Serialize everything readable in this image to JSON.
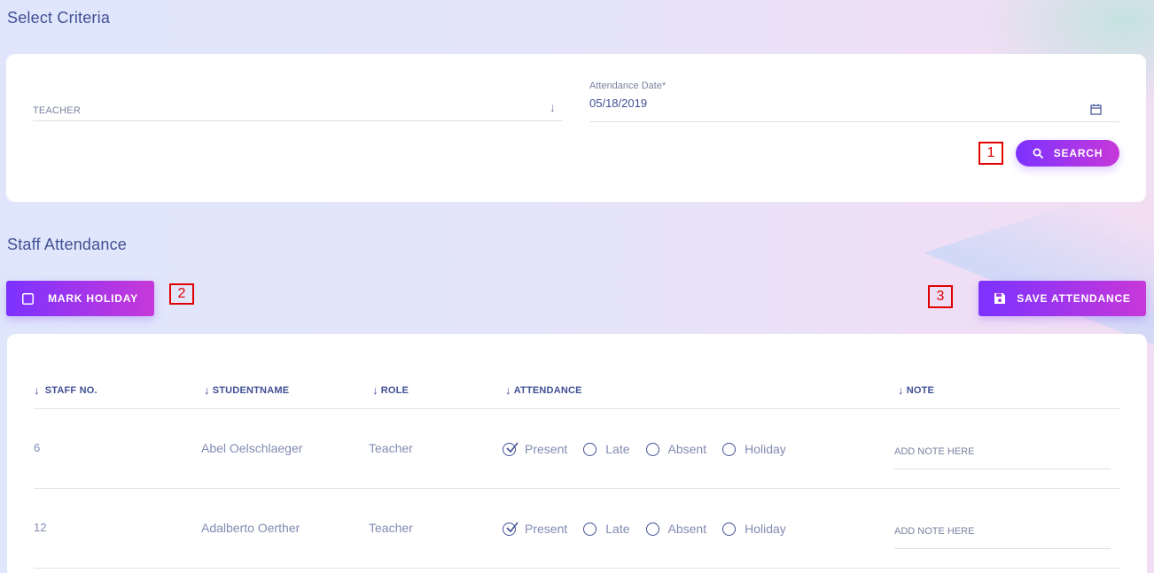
{
  "criteria": {
    "title": "Select Criteria",
    "teacher_label": "TEACHER",
    "date_label": "Attendance Date*",
    "date_value": "05/18/2019",
    "search_label": "SEARCH"
  },
  "attendance": {
    "title": "Staff Attendance",
    "mark_holiday_label": "MARK HOLIDAY",
    "save_label": "SAVE ATTENDANCE",
    "columns": [
      "STAFF NO.",
      "STUDENTNAME",
      "ROLE",
      "ATTENDANCE",
      "NOTE"
    ],
    "options": [
      "Present",
      "Late",
      "Absent",
      "Holiday"
    ],
    "note_placeholder": "ADD NOTE HERE",
    "rows": [
      {
        "staff_no": "6",
        "name": "Abel Oelschlaeger",
        "role": "Teacher",
        "selected": "Present"
      },
      {
        "staff_no": "12",
        "name": "Adalberto Oerther",
        "role": "Teacher",
        "selected": "Present"
      }
    ]
  },
  "markers": [
    "1",
    "2",
    "3"
  ],
  "colors": {
    "accent_start": "#7c32ff",
    "accent_end": "#c738d8",
    "text_primary": "#415094",
    "text_muted": "#828bb2",
    "marker": "#e00000"
  }
}
